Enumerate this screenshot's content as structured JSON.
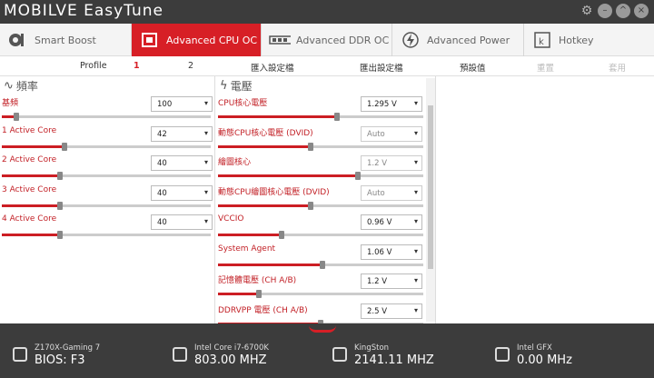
{
  "app": {
    "title": "MOBILVE EasyTune",
    "window_icons": [
      "gear-icon",
      "minimize-icon",
      "maximize-icon",
      "close-icon"
    ]
  },
  "tabs": [
    {
      "label": "Smart Boost",
      "icon": "smart-boost-icon",
      "active": false
    },
    {
      "label": "Advanced CPU OC",
      "icon": "cpu-icon",
      "active": true
    },
    {
      "label": "Advanced DDR OC",
      "icon": "ddr-icon",
      "active": false
    },
    {
      "label": "Advanced Power",
      "icon": "power-icon",
      "active": false
    },
    {
      "label": "Hotkey",
      "icon": "hotkey-icon",
      "active": false
    }
  ],
  "subbar": {
    "profile": "Profile",
    "p1": "1",
    "p2": "2",
    "import": "匯入設定檔",
    "export": "匯出設定檔",
    "default": "預設值",
    "reset": "重置",
    "apply": "套用"
  },
  "freq": {
    "title": "頻率",
    "items": [
      {
        "label": "基頻",
        "value": "100",
        "level": 0.07
      },
      {
        "label": "1 Active Core",
        "value": "42",
        "level": 0.3
      },
      {
        "label": "2 Active Core",
        "value": "40",
        "level": 0.28
      },
      {
        "label": "3 Active Core",
        "value": "40",
        "level": 0.28
      },
      {
        "label": "4 Active Core",
        "value": "40",
        "level": 0.28
      }
    ]
  },
  "volt": {
    "title": "電壓",
    "items": [
      {
        "label": "CPU核心電壓",
        "value": "1.295 V",
        "disabled": false,
        "level": 0.58
      },
      {
        "label": "動態CPU核心電壓 (DVID)",
        "value": "Auto",
        "disabled": true,
        "level": 0.45
      },
      {
        "label": "繪圖核心",
        "value": "1.2 V",
        "disabled": true,
        "level": 0.68
      },
      {
        "label": "動態CPU繪圖核心電壓 (DVID)",
        "value": "Auto",
        "disabled": true,
        "level": 0.45
      },
      {
        "label": "VCCIO",
        "value": "0.96 V",
        "disabled": false,
        "level": 0.31
      },
      {
        "label": "System Agent",
        "value": "1.06 V",
        "disabled": false,
        "level": 0.51
      },
      {
        "label": "記憶體電壓 (CH A/B)",
        "value": "1.2 V",
        "disabled": false,
        "level": 0.2
      },
      {
        "label": "DDRVPP 電壓 (CH A/B)",
        "value": "2.5 V",
        "disabled": false,
        "level": 0.5
      }
    ]
  },
  "footer": [
    {
      "small": "Z170X-Gaming 7",
      "big": "BIOS: F3",
      "icon": "motherboard-icon"
    },
    {
      "small": "Intel Core i7-6700K",
      "big": "803.00 MHZ",
      "icon": "cpu-chip-icon"
    },
    {
      "small": "KingSton",
      "big": "2141.11 MHZ",
      "icon": "memory-icon"
    },
    {
      "small": "Intel GFX",
      "big": "0.00 MHz",
      "icon": "gpu-icon"
    }
  ]
}
